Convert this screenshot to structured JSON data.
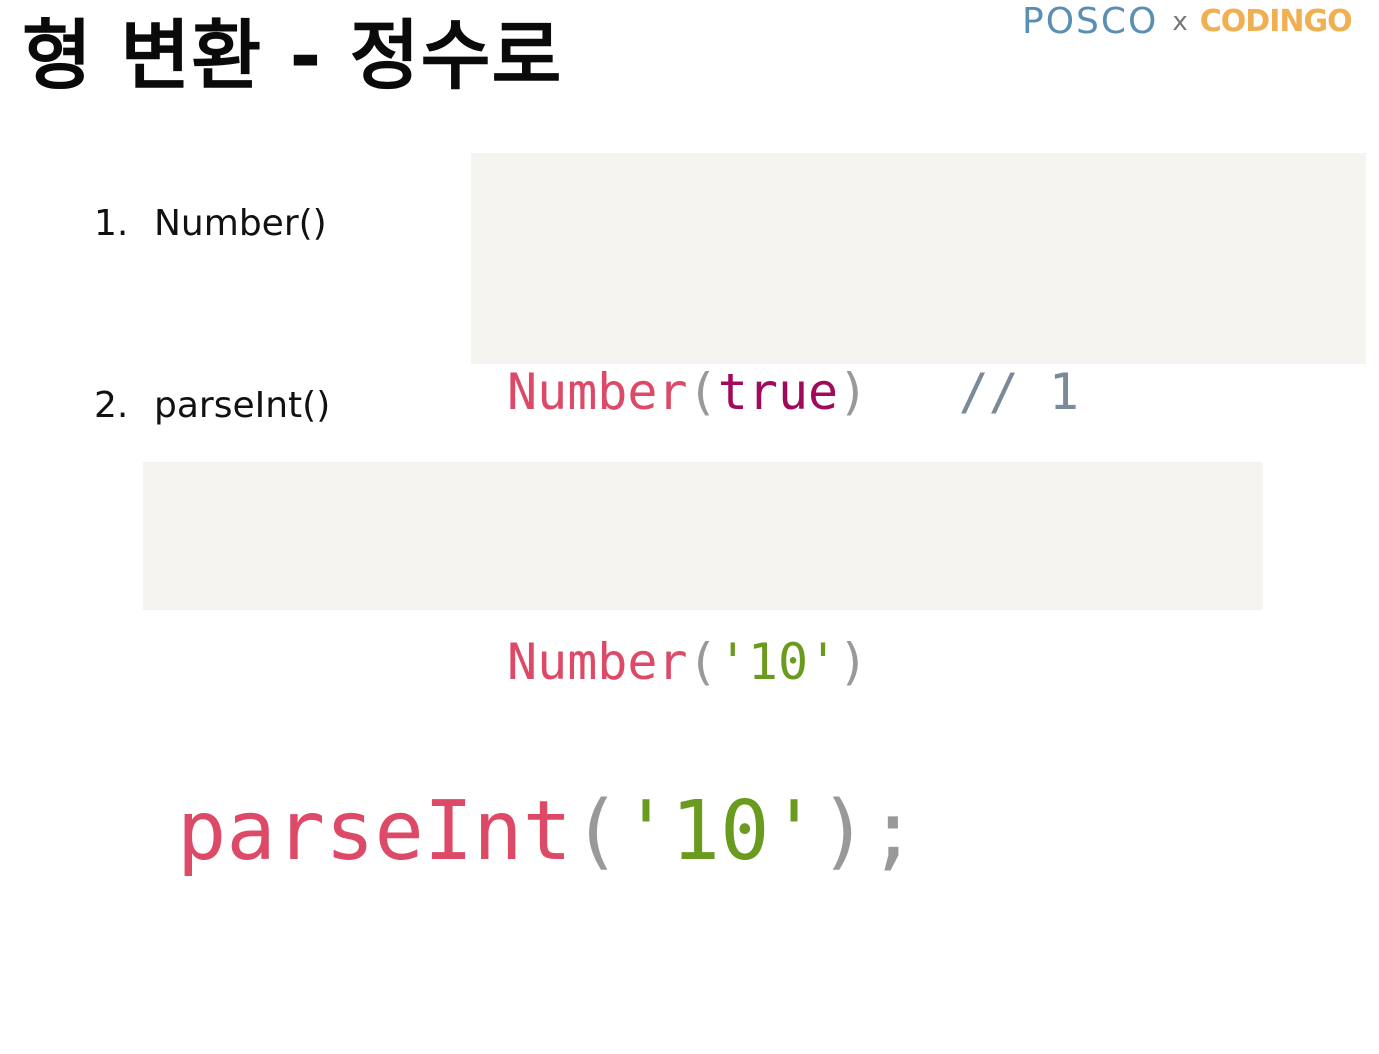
{
  "slide": {
    "title": "형 변환 - 정수로"
  },
  "logo": {
    "left": "POSCO",
    "separator": "x",
    "right": "CODINGO"
  },
  "items": [
    {
      "number": "1.",
      "label": "Number()"
    },
    {
      "number": "2.",
      "label": "parseInt()"
    }
  ],
  "code_blocks": {
    "number_example": {
      "line1": {
        "fn": "Number",
        "open": "(",
        "arg": "true",
        "close": ")",
        "comment": "// 1"
      },
      "line2": {
        "fn": "Number",
        "open": "(",
        "arg": "'10'",
        "close": ")"
      }
    },
    "parseint_example": {
      "fn": "parseInt",
      "open": "(",
      "arg": "'10'",
      "close": ")",
      "end": ";"
    }
  },
  "colors": {
    "function": "#dd4a68",
    "keyword": "#a0095c",
    "string": "#6a9b1e",
    "punctuation": "#999999",
    "comment": "#7a8a99",
    "code_background": "#f6f4f1",
    "logo_posco": "#5a8fb4",
    "logo_codingo": "#f0b052"
  }
}
